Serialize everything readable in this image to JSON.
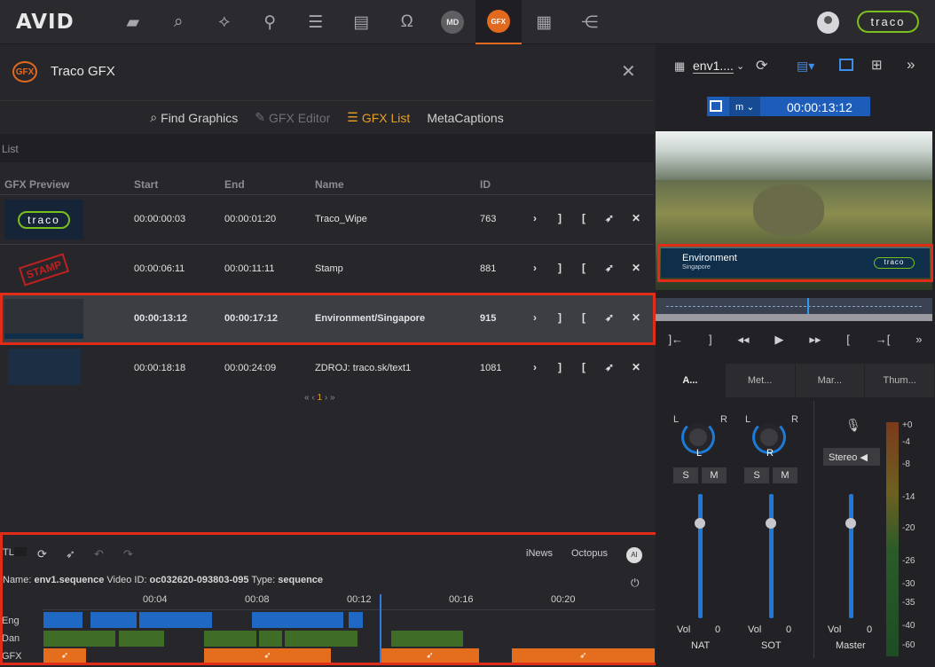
{
  "app": {
    "brand": "AVID",
    "partner": "traco"
  },
  "nav": [
    "folder-icon",
    "search-icon",
    "link-icon",
    "person-icon",
    "server-icon",
    "inbox-icon",
    "headphones-icon",
    "MD",
    "GFX",
    "film-icon",
    "share-icon"
  ],
  "panel": {
    "title": "Traco GFX",
    "logo": "GFX"
  },
  "tabs": [
    {
      "label": "Find Graphics",
      "state": "normal"
    },
    {
      "label": "GFX Editor",
      "state": "disabled"
    },
    {
      "label": "GFX List",
      "state": "active"
    },
    {
      "label": "MetaCaptions",
      "state": "normal"
    }
  ],
  "list": {
    "label": "List",
    "columns": [
      "GFX Preview",
      "Start",
      "End",
      "Name",
      "ID"
    ],
    "rows": [
      {
        "start": "00:00:00:03",
        "end": "00:00:01:20",
        "name": "Traco_Wipe",
        "id": "763",
        "preview": "traco"
      },
      {
        "start": "00:00:06:11",
        "end": "00:00:11:11",
        "name": "Stamp",
        "id": "881",
        "preview": "STAMP"
      },
      {
        "start": "00:00:13:12",
        "end": "00:00:17:12",
        "name": "Environment/Singapore",
        "id": "915",
        "preview": ""
      },
      {
        "start": "00:00:18:18",
        "end": "00:00:24:09",
        "name": "ZDROJ: traco.sk/text1",
        "id": "1081",
        "preview": ""
      }
    ],
    "pager": {
      "first": "«",
      "prev": "‹",
      "current": "1",
      "next": "›",
      "last": "»"
    }
  },
  "timeline": {
    "tl_label": "TL",
    "inews": "iNews",
    "octopus": "Octopus",
    "info_name_label": "Name:",
    "info_name": "env1.sequence",
    "info_vid_label": "Video ID:",
    "info_vid": "oc032620-093803-095",
    "info_type_label": "Type:",
    "info_type": "sequence",
    "ruler": [
      "00:04",
      "00:08",
      "00:12",
      "00:16",
      "00:20"
    ],
    "tracks": [
      "Eng",
      "Dan",
      "GFX"
    ]
  },
  "viewer": {
    "clip_name": "env1....",
    "mode": "m",
    "timecode": "00:00:13:12",
    "lower_third_title": "Environment",
    "lower_third_sub": "Singapore",
    "lower_third_logo": "traco"
  },
  "audio": {
    "tabs": [
      "A...",
      "Met...",
      "Mar...",
      "Thum..."
    ],
    "channels": [
      {
        "name": "NAT",
        "pan": "L",
        "vol": "0",
        "l": "L",
        "r": "R",
        "s": "S",
        "m": "M"
      },
      {
        "name": "SOT",
        "pan": "R",
        "vol": "0",
        "l": "L",
        "r": "R",
        "s": "S",
        "m": "M"
      },
      {
        "name": "Master",
        "mode": "Stereo",
        "vol": "0"
      }
    ],
    "vol_label": "Vol",
    "meter_labels": [
      "+0",
      "-4",
      "-8",
      "-14",
      "-20",
      "-26",
      "-30",
      "-35",
      "-40",
      "-60"
    ]
  }
}
